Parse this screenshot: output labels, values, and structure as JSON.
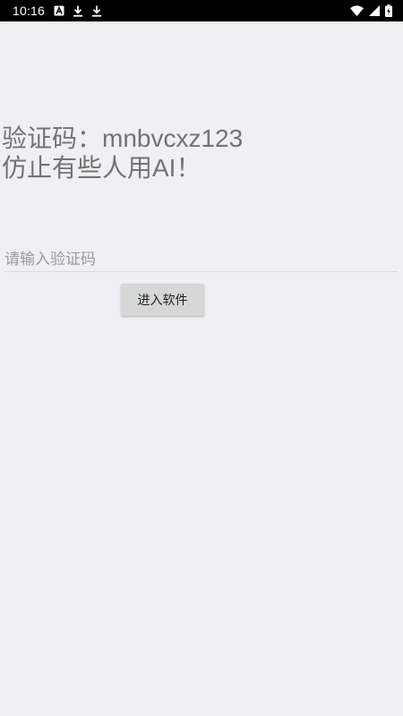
{
  "status_bar": {
    "time": "10:16",
    "left_icons": [
      "font-a-icon",
      "download-icon",
      "download-icon"
    ],
    "right_icons": [
      "wifi-icon",
      "cell-signal-icon",
      "battery-charging-icon"
    ]
  },
  "main": {
    "captcha_line1": "验证码：mnbvcxz123",
    "captcha_line2": "仿止有些人用AI！",
    "code_input": {
      "placeholder": "请输入验证码",
      "value": ""
    },
    "enter_button_label": "进入软件"
  },
  "colors": {
    "background": "#f0eff4",
    "status_bar": "#000000",
    "label_text": "#737373",
    "button_bg": "#d6d7d7"
  }
}
